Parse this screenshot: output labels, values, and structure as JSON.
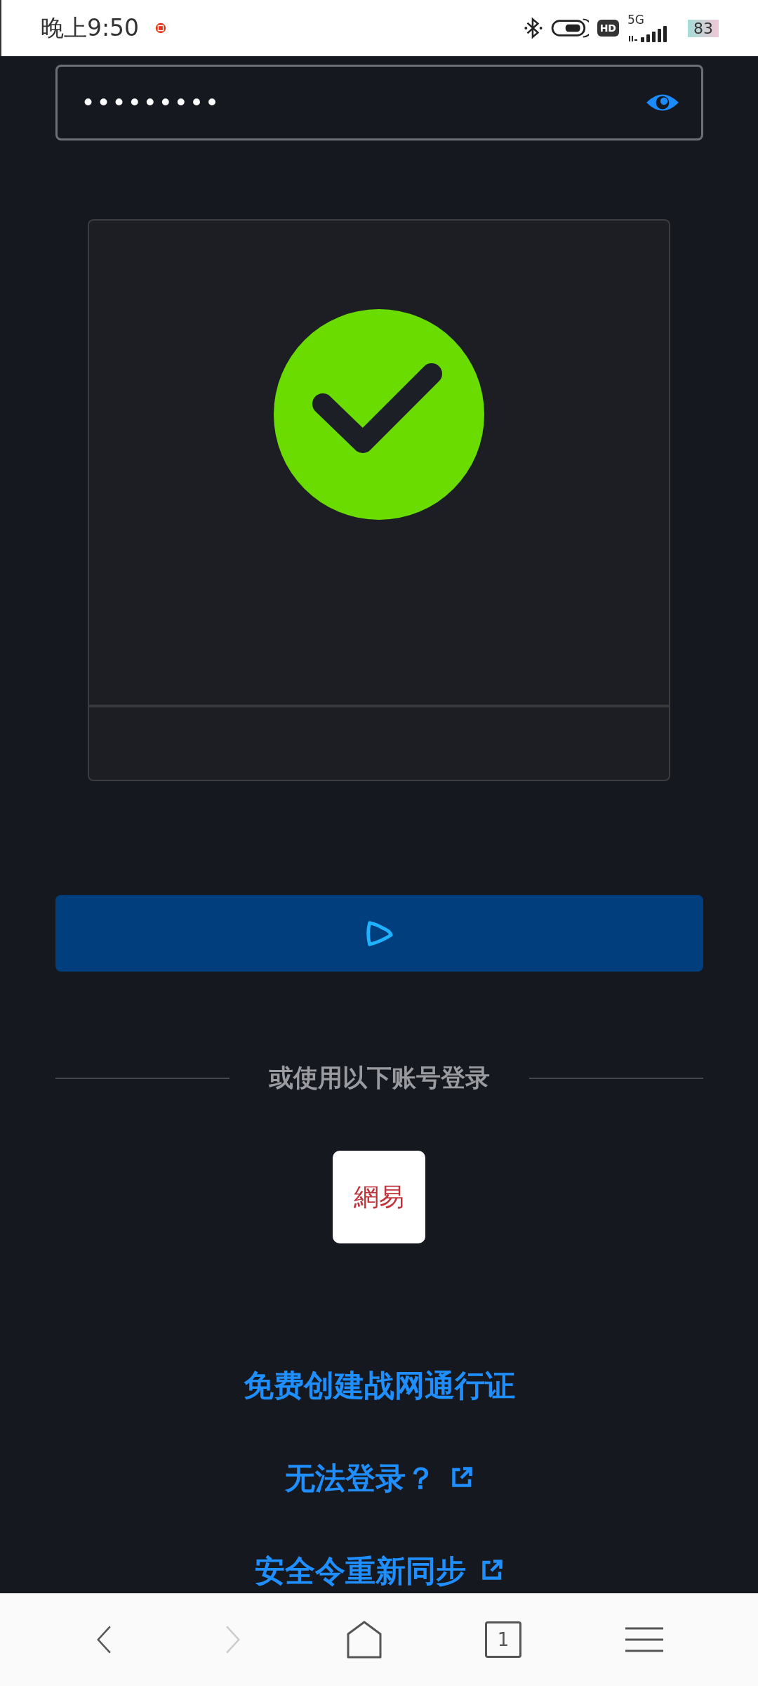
{
  "status_bar": {
    "time": "晚上9:50",
    "network": "5G",
    "hd": "HD",
    "battery": "83"
  },
  "password_field": {
    "value": "•••••••••"
  },
  "captcha": {
    "verified": true
  },
  "login_button": {
    "loading": true
  },
  "divider": {
    "label": "或使用以下账号登录"
  },
  "social_logins": [
    {
      "label": "網易"
    }
  ],
  "links": [
    {
      "label": "免费创建战网通行证",
      "external": false
    },
    {
      "label": "无法登录？",
      "external": true
    },
    {
      "label": "安全令重新同步",
      "external": true
    }
  ],
  "nav_bar": {
    "tab_count": "1",
    "back_disabled": false,
    "forward_disabled": true
  }
}
